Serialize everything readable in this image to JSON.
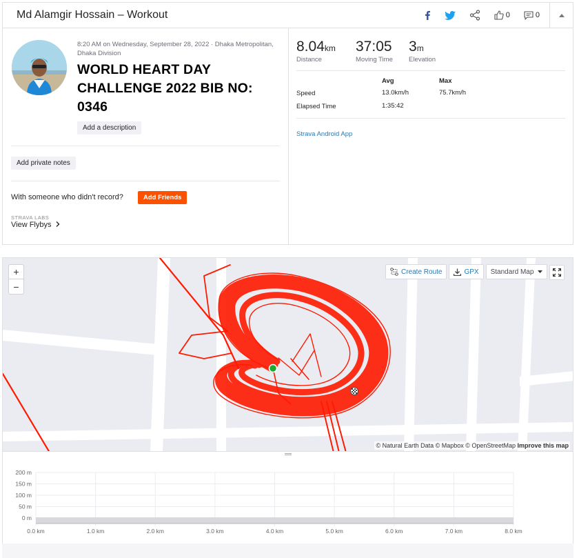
{
  "header": {
    "title": "Md Alamgir Hossain – Workout",
    "kudos_count": "0",
    "comments_count": "0",
    "icons": [
      "facebook-icon",
      "twitter-icon",
      "share-icon",
      "thumbs-up-icon",
      "comment-icon",
      "chevron-up-icon"
    ]
  },
  "activity": {
    "meta": "8:20 AM on Wednesday, September 28, 2022 · Dhaka Metropolitan, Dhaka Division",
    "title": "WORLD HEART DAY CHALLENGE 2022 BIB NO: 0346",
    "add_description": "Add a description",
    "add_private_notes": "Add private notes",
    "with_someone": "With someone who didn't record?",
    "add_friends": "Add Friends",
    "labs_label": "STRAVA LABS",
    "view_flybys": "View Flybys"
  },
  "stats": {
    "distance": {
      "value": "8.04",
      "unit": "km",
      "label": "Distance"
    },
    "moving_time": {
      "value": "37:05",
      "label": "Moving Time"
    },
    "elevation": {
      "value": "3",
      "unit": "m",
      "label": "Elevation"
    },
    "table": {
      "head_avg": "Avg",
      "head_max": "Max",
      "speed_label": "Speed",
      "speed_avg": "13.0km/h",
      "speed_max": "75.7km/h",
      "elapsed_label": "Elapsed Time",
      "elapsed_avg": "1:35:42"
    },
    "device": "Strava Android App"
  },
  "map": {
    "zoom_in": "+",
    "zoom_out": "−",
    "create_route": "Create Route",
    "gpx": "GPX",
    "map_type": "Standard Map",
    "attribution_plain": "© Natural Earth Data © Mapbox © OpenStreetMap ",
    "attribution_link": "Improve this map",
    "route_color": "#ff1a00",
    "start_color": "#1aab2f"
  },
  "elevation_chart": {
    "y_ticks": [
      "200 m",
      "150 m",
      "100 m",
      "50 m",
      "0 m"
    ],
    "x_ticks": [
      "0.0 km",
      "1.0 km",
      "2.0 km",
      "3.0 km",
      "4.0 km",
      "5.0 km",
      "6.0 km",
      "7.0 km",
      "8.0 km"
    ]
  },
  "colors": {
    "accent": "#fc5200",
    "link": "#2a7ab0"
  }
}
